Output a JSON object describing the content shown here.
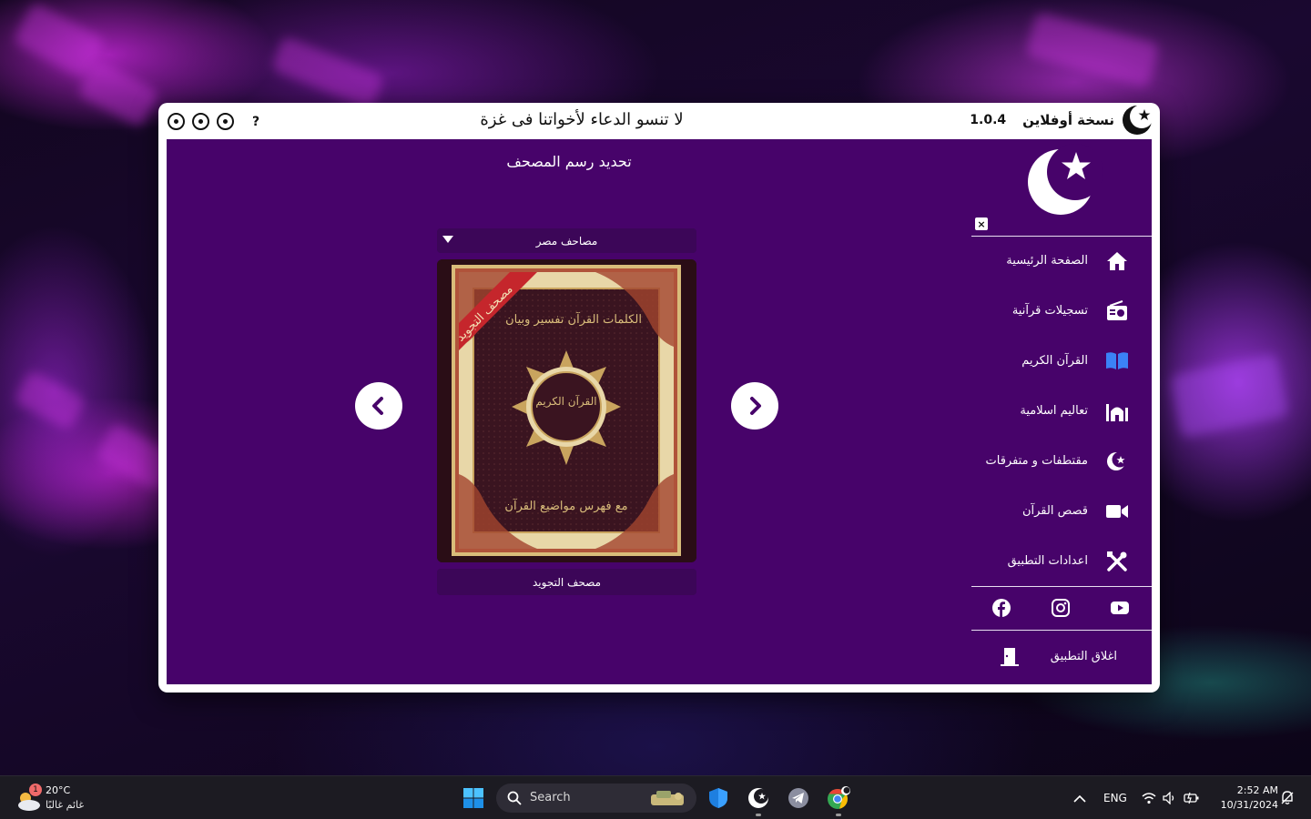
{
  "window": {
    "brand_name": "نسخة أوفلاين",
    "version": "1.0.4",
    "banner": "لا تنسو الدعاء لأخواتنا فى غزة",
    "help_label": "?"
  },
  "main": {
    "page_title": "تحديد رسم المصحف",
    "selector_value": "مصاحف مصر",
    "cover_caption": "مصحف التجويد",
    "cover_art": {
      "ribbon_text": "مصحف التجويد",
      "top_text": "الكلمات القرآن تفسير وبيان",
      "center_text": "القرآن الكريم",
      "bottom_text": "مع فهرس مواضيع القرآن"
    }
  },
  "sidebar": {
    "close_label": "×",
    "items": [
      {
        "label": "الصفحة الرئيسية",
        "icon": "home-icon"
      },
      {
        "label": "تسجيلات قرآنية",
        "icon": "radio-icon"
      },
      {
        "label": "القرآن الكريم",
        "icon": "book-open-icon"
      },
      {
        "label": "تعاليم اسلامية",
        "icon": "mosque-icon"
      },
      {
        "label": "مقتطفات و متفرقات",
        "icon": "crescent-star-icon"
      },
      {
        "label": "قصص القرآن",
        "icon": "video-camera-icon"
      },
      {
        "label": "اعدادات التطبيق",
        "icon": "tools-icon"
      }
    ],
    "social": [
      "facebook-icon",
      "instagram-icon",
      "youtube-icon"
    ],
    "exit_label": "اغلاق التطبيق"
  },
  "taskbar": {
    "weather_temp": "20°C",
    "weather_condition": "غائم غالبًا",
    "weather_badge": "1",
    "search_placeholder": "Search",
    "language": "ENG",
    "time": "2:52 AM",
    "date": "10/31/2024"
  },
  "colors": {
    "main_bg": "#47036a",
    "panel_bg": "#3c0658",
    "window_bg": "#ffffff",
    "taskbar_bg": "#1c1b22"
  }
}
